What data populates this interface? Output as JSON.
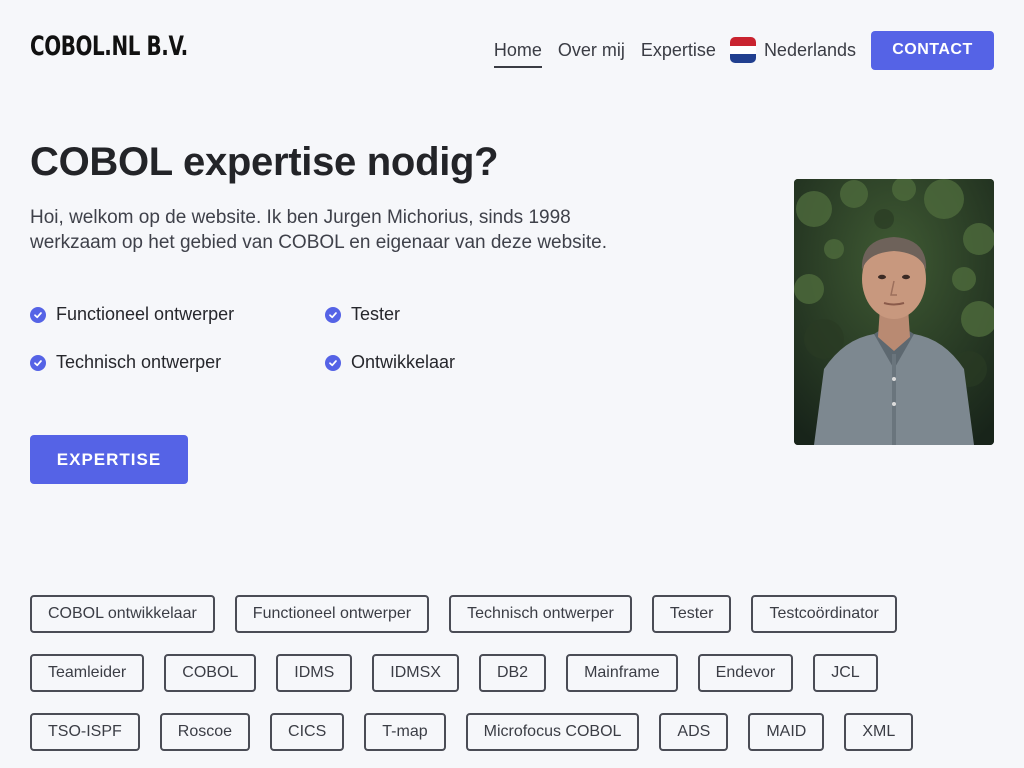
{
  "header": {
    "logo": "COBOL.NL B.V.",
    "nav": [
      {
        "label": "Home",
        "active": true
      },
      {
        "label": "Over mij",
        "active": false
      },
      {
        "label": "Expertise",
        "active": false
      }
    ],
    "language": {
      "label": "Nederlands",
      "flag_icon": "netherlands-flag-icon"
    },
    "contact_label": "CONTACT"
  },
  "hero": {
    "title": "COBOL expertise nodig?",
    "intro": "Hoi, welkom op de website. Ik ben Jurgen Michorius, sinds 1998 werkzaam op het gebied van COBOL en eigenaar van deze website.",
    "skills": [
      "Functioneel ontwerper",
      "Tester",
      "Technisch ontwerper",
      "Ontwikkelaar"
    ],
    "cta_label": "EXPERTISE"
  },
  "tags": {
    "rows": [
      [
        "COBOL ontwikkelaar",
        "Functioneel ontwerper",
        "Technisch ontwerper",
        "Tester",
        "Testcoördinator"
      ],
      [
        "Teamleider",
        "COBOL",
        "IDMS",
        "IDMSX",
        "DB2",
        "Mainframe",
        "Endevor",
        "JCL"
      ],
      [
        "TSO-ISPF",
        "Roscoe",
        "CICS",
        "T-map",
        "Microfocus COBOL",
        "ADS",
        "MAID",
        "XML"
      ]
    ]
  },
  "colors": {
    "accent": "#5563e6",
    "background": "#f6f7fa",
    "text": "#232428"
  }
}
